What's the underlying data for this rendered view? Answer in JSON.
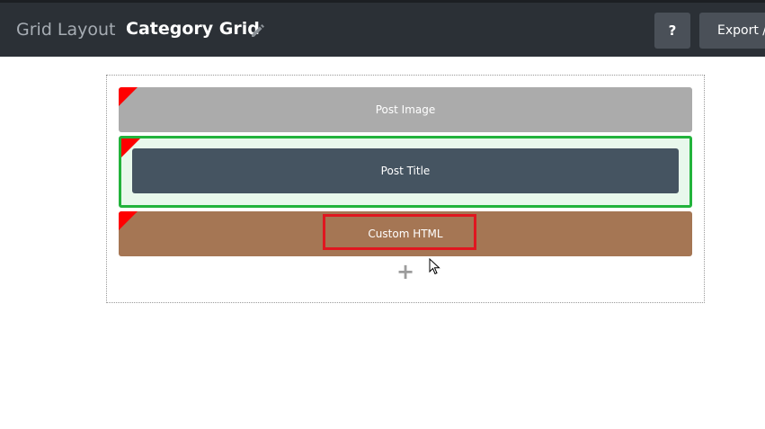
{
  "header": {
    "app_title": "Grid Layout",
    "page_title": "Category Grid",
    "edit_icon": "pencil-icon",
    "help_label": "?",
    "export_label": "Export /"
  },
  "canvas": {
    "blocks": [
      {
        "label": "Post Image",
        "color": "#ababab"
      },
      {
        "label": "Post Title",
        "color": "#455461",
        "selected": true,
        "selected_color": "#22b33c"
      },
      {
        "label": "Custom HTML",
        "color": "#a57654",
        "highlight_color": "#e0161f"
      }
    ],
    "add_label": "+",
    "corner_color": "#ff0000"
  }
}
